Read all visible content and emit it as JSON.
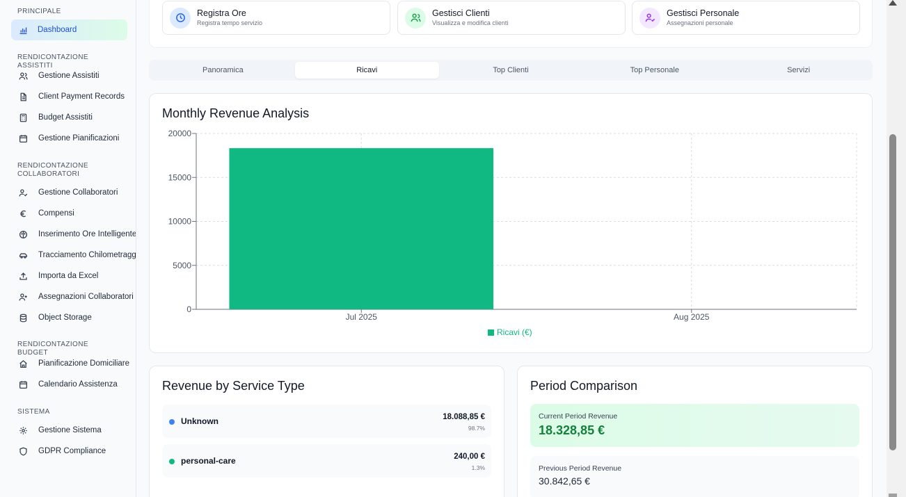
{
  "sidebar": {
    "sections": [
      {
        "title": "PRINCIPALE",
        "items": [
          {
            "label": "Dashboard",
            "icon": "chart-icon",
            "active": true
          }
        ]
      },
      {
        "title": "RENDICONTAZIONE ASSISTITI",
        "items": [
          {
            "label": "Gestione Assistiti",
            "icon": "users-icon"
          },
          {
            "label": "Client Payment Records",
            "icon": "document-icon"
          },
          {
            "label": "Budget Assistiti",
            "icon": "calculator-icon"
          },
          {
            "label": "Gestione Pianificazioni",
            "icon": "calendar-icon"
          }
        ]
      },
      {
        "title": "RENDICONTAZIONE COLLABORATORI",
        "items": [
          {
            "label": "Gestione Collaboratori",
            "icon": "user-check-icon"
          },
          {
            "label": "Compensi",
            "icon": "euro-icon"
          },
          {
            "label": "Inserimento Ore Intelligente",
            "icon": "brain-icon"
          },
          {
            "label": "Tracciamento Chilometraggio",
            "icon": "car-icon"
          },
          {
            "label": "Importa da Excel",
            "icon": "upload-icon"
          },
          {
            "label": "Assegnazioni Collaboratori",
            "icon": "user-plus-icon"
          },
          {
            "label": "Object Storage",
            "icon": "database-icon"
          }
        ]
      },
      {
        "title": "RENDICONTAZIONE BUDGET",
        "items": [
          {
            "label": "Pianificazione Domiciliare",
            "icon": "home-icon"
          },
          {
            "label": "Calendario Assistenza",
            "icon": "calendar-icon"
          }
        ]
      },
      {
        "title": "SISTEMA",
        "items": [
          {
            "label": "Gestione Sistema",
            "icon": "gear-icon"
          },
          {
            "label": "GDPR Compliance",
            "icon": "shield-icon"
          }
        ]
      }
    ]
  },
  "quick_actions": [
    {
      "title": "Registra Ore",
      "subtitle": "Registra tempo servizio",
      "icon": "clock-icon",
      "color": "#2563eb",
      "bg": "#dbeafe"
    },
    {
      "title": "Gestisci Clienti",
      "subtitle": "Visualizza e modifica clienti",
      "icon": "users-icon",
      "color": "#16a34a",
      "bg": "#dcfce7"
    },
    {
      "title": "Gestisci Personale",
      "subtitle": "Assegnazioni personale",
      "icon": "user-check-icon",
      "color": "#9333ea",
      "bg": "#f3e8ff"
    }
  ],
  "tabs": [
    {
      "label": "Panoramica",
      "active": false
    },
    {
      "label": "Ricavi",
      "active": true
    },
    {
      "label": "Top Clienti",
      "active": false
    },
    {
      "label": "Top Personale",
      "active": false
    },
    {
      "label": "Servizi",
      "active": false
    }
  ],
  "revenue_chart": {
    "title": "Monthly Revenue Analysis",
    "legend": "Ricavi (€)"
  },
  "chart_data": {
    "type": "bar",
    "title": "Monthly Revenue Analysis",
    "categories": [
      "Jul 2025",
      "Aug 2025"
    ],
    "series": [
      {
        "name": "Ricavi (€)",
        "values": [
          18328.85,
          0
        ],
        "color": "#10b981"
      }
    ],
    "ylim": [
      0,
      20000
    ],
    "yticks": [
      0,
      5000,
      10000,
      15000,
      20000
    ],
    "grid": true,
    "legend_position": "bottom"
  },
  "service_revenue": {
    "title": "Revenue by Service Type",
    "items": [
      {
        "name": "Unknown",
        "amount": "18.088,85 €",
        "percent": "98.7%",
        "color": "#3b82f6"
      },
      {
        "name": "personal-care",
        "amount": "240,00 €",
        "percent": "1.3%",
        "color": "#10b981"
      }
    ]
  },
  "period_comparison": {
    "title": "Period Comparison",
    "current_label": "Current Period Revenue",
    "current_value": "18.328,85 €",
    "previous_label": "Previous Period Revenue",
    "previous_value": "30.842,65 €"
  },
  "colors": {
    "accent": "#10b981",
    "brand_blue": "#1d4ed8"
  }
}
